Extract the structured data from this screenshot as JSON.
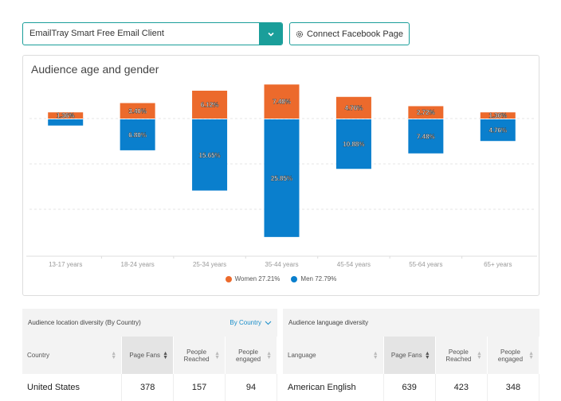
{
  "header": {
    "selected_app": "EmailTray Smart Free Email Client",
    "connect_button": "Connect Facebook Page"
  },
  "colors": {
    "accent": "#1a9e9a",
    "women": "#ec6a2c",
    "men": "#0a7fcd",
    "link": "#1a8ec9"
  },
  "chart_data": {
    "type": "bar",
    "title": "Audience age and gender",
    "categories": [
      "13-17 years",
      "18-24 years",
      "25-34 years",
      "35-44 years",
      "45-54 years",
      "55-64 years",
      "65+ years"
    ],
    "series": [
      {
        "name": "Women",
        "values": [
          1.36,
          3.4,
          6.12,
          7.48,
          4.76,
          2.72,
          1.36
        ],
        "labels": [
          "1.36%",
          "3.40%",
          "6.12%",
          "7.48%",
          "4.76%",
          "2.72%",
          "1.36%"
        ],
        "direction": "up"
      },
      {
        "name": "Men",
        "values": [
          1.36,
          6.8,
          15.65,
          25.85,
          10.88,
          7.48,
          4.76
        ],
        "labels": [
          "",
          "6.80%",
          "15.65%",
          "25.85%",
          "10.88%",
          "7.48%",
          "4.76%"
        ],
        "direction": "down"
      }
    ],
    "legend": [
      {
        "name": "Women",
        "text": "Women 27.21%"
      },
      {
        "name": "Men",
        "text": "Men 72.79%"
      }
    ],
    "legend_position": "bottom",
    "grid": true,
    "ylim": [
      -26,
      8
    ]
  },
  "location_table": {
    "title": "Audience location diversity (By Country)",
    "filter_label": "By Country",
    "columns": [
      "Country",
      "Page Fans",
      "People Reached",
      "People engaged"
    ],
    "sorted_column": "Page Fans",
    "rows": [
      [
        "United States",
        "378",
        "157",
        "94"
      ]
    ]
  },
  "language_table": {
    "title": "Audience language diversity",
    "columns": [
      "Language",
      "Page Fans",
      "People Reached",
      "People engaged"
    ],
    "sorted_column": "Page Fans",
    "rows": [
      [
        "American English",
        "639",
        "423",
        "348"
      ]
    ]
  }
}
